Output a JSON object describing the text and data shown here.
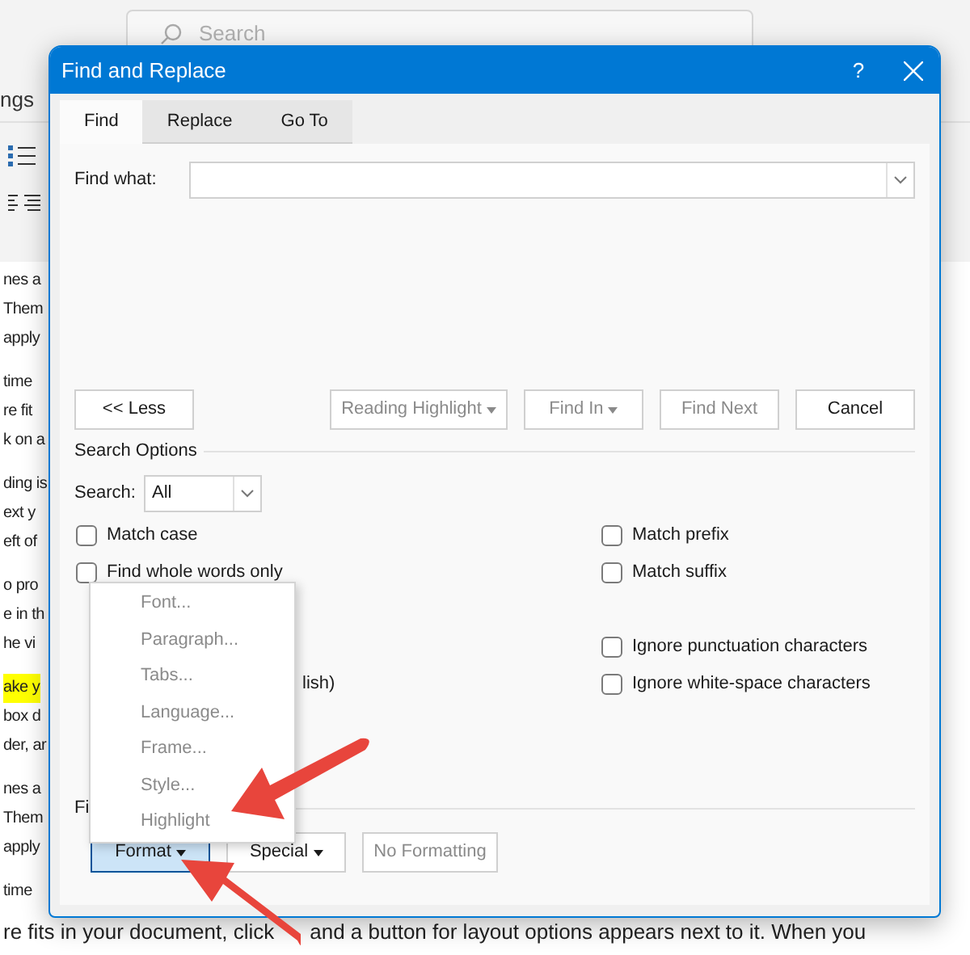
{
  "background": {
    "search": {
      "placeholder": "Search"
    },
    "ribbon_label": "ngs",
    "paragraphs": [
      [
        {
          "text": "nes a",
          "highlighted": false
        },
        {
          "text": "Them",
          "highlighted": false
        },
        {
          "text": "apply",
          "highlighted": false
        }
      ],
      [
        {
          "text": "time",
          "highlighted": false
        },
        {
          "text": "re fit",
          "highlighted": false
        },
        {
          "text": "k on a",
          "highlighted": false
        }
      ],
      [
        {
          "text": "ding is",
          "highlighted": false
        },
        {
          "text": "ext y",
          "highlighted": false
        },
        {
          "text": "eft of",
          "highlighted": false
        }
      ],
      [
        {
          "text": "o pro",
          "highlighted": false
        },
        {
          "text": "e in th",
          "highlighted": false
        },
        {
          "text": "he vi",
          "highlighted": false
        }
      ],
      [
        {
          "text": "ake y",
          "highlighted": true
        },
        {
          "text": "box d",
          "highlighted": false
        },
        {
          "text": "der, ar",
          "highlighted": false
        }
      ],
      [
        {
          "text": "nes a",
          "highlighted": false
        },
        {
          "text": "Them",
          "highlighted": false
        },
        {
          "text": "apply",
          "highlighted": false
        }
      ],
      [
        {
          "text": "time",
          "highlighted": false
        }
      ]
    ],
    "bottom_line": [
      "re fits in your document, click",
      "and a button for layout options appears next to it. When you"
    ]
  },
  "window": {
    "title": "Find and Replace",
    "help": "?"
  },
  "tabs": [
    {
      "label": "Find",
      "selected": true
    },
    {
      "label": "Replace",
      "selected": false
    },
    {
      "label": "Go To",
      "selected": false
    }
  ],
  "find_what": {
    "label": "Find what:"
  },
  "buttons": [
    {
      "label": "<< Less",
      "caret": false,
      "disabled": false
    },
    {
      "label": "Reading Highlight",
      "caret": true,
      "disabled": true
    },
    {
      "label": "Find In",
      "caret": true,
      "disabled": true
    },
    {
      "label": "Find Next",
      "caret": false,
      "disabled": true
    },
    {
      "label": "Cancel",
      "caret": false,
      "disabled": false
    }
  ],
  "search_options": {
    "heading": "Search Options",
    "search_label": "Search:",
    "search_value": "All",
    "left": [
      [
        {
          "kind": "checkbox",
          "label": "Match case",
          "checked": false
        },
        {
          "kind": "checkbox",
          "label": "Find whole words only",
          "checked": false
        }
      ],
      [
        {
          "kind": "fragment",
          "label": "lish)"
        }
      ]
    ],
    "right": [
      [
        {
          "kind": "checkbox",
          "label": "Match prefix",
          "checked": false
        },
        {
          "kind": "checkbox",
          "label": "Match suffix",
          "checked": false
        }
      ],
      [
        {
          "kind": "checkbox",
          "label": "Ignore punctuation characters",
          "checked": false
        },
        {
          "kind": "checkbox",
          "label": "Ignore white-space characters",
          "checked": false
        }
      ]
    ]
  },
  "find_section": {
    "heading": "Fi",
    "buttons": [
      {
        "label": "Format",
        "caret": true,
        "disabled": false,
        "pressed": true
      },
      {
        "label": "Special",
        "caret": true,
        "disabled": false,
        "pressed": false
      },
      {
        "label": "No Formatting",
        "caret": false,
        "disabled": true,
        "pressed": false
      }
    ]
  },
  "format_menu": [
    "Font...",
    "Paragraph...",
    "Tabs...",
    "Language...",
    "Frame...",
    "Style...",
    "Highlight"
  ]
}
